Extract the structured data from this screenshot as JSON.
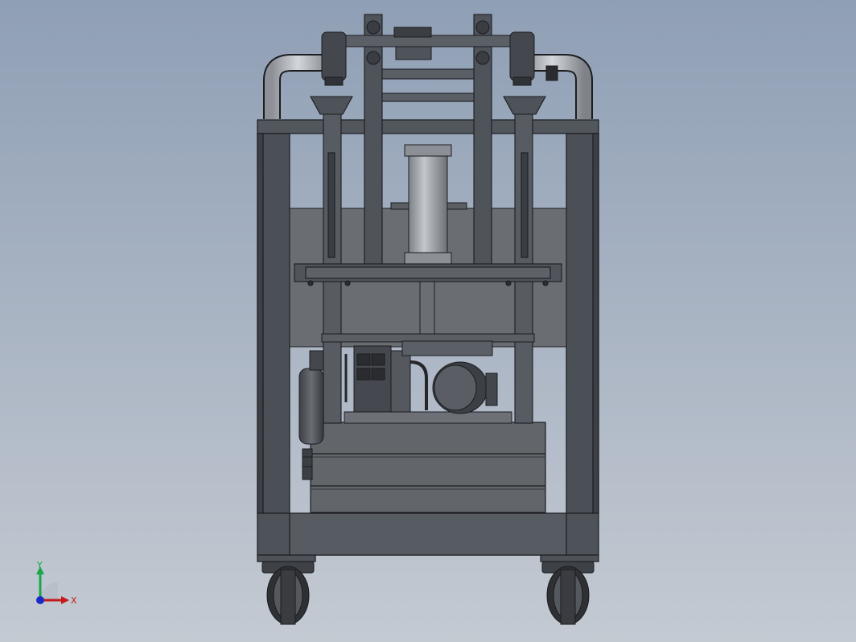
{
  "viewport": {
    "background_top": "#8f9fb5",
    "background_bottom": "#c4cad2"
  },
  "model": {
    "frame_color": "#4e5259",
    "frame_dark": "#3a3d43",
    "panel_color": "#6a6d72",
    "pipe_color": "#b8bcc2",
    "edge_color": "#1b1d20",
    "wheel_color": "#2e3034",
    "cylinder_color": "#a9adb3"
  },
  "triad": {
    "x_label": "X",
    "y_label": "Y",
    "x_color": "#c41a1a",
    "y_color": "#1aa64a",
    "z_color": "#1a2bc4"
  }
}
